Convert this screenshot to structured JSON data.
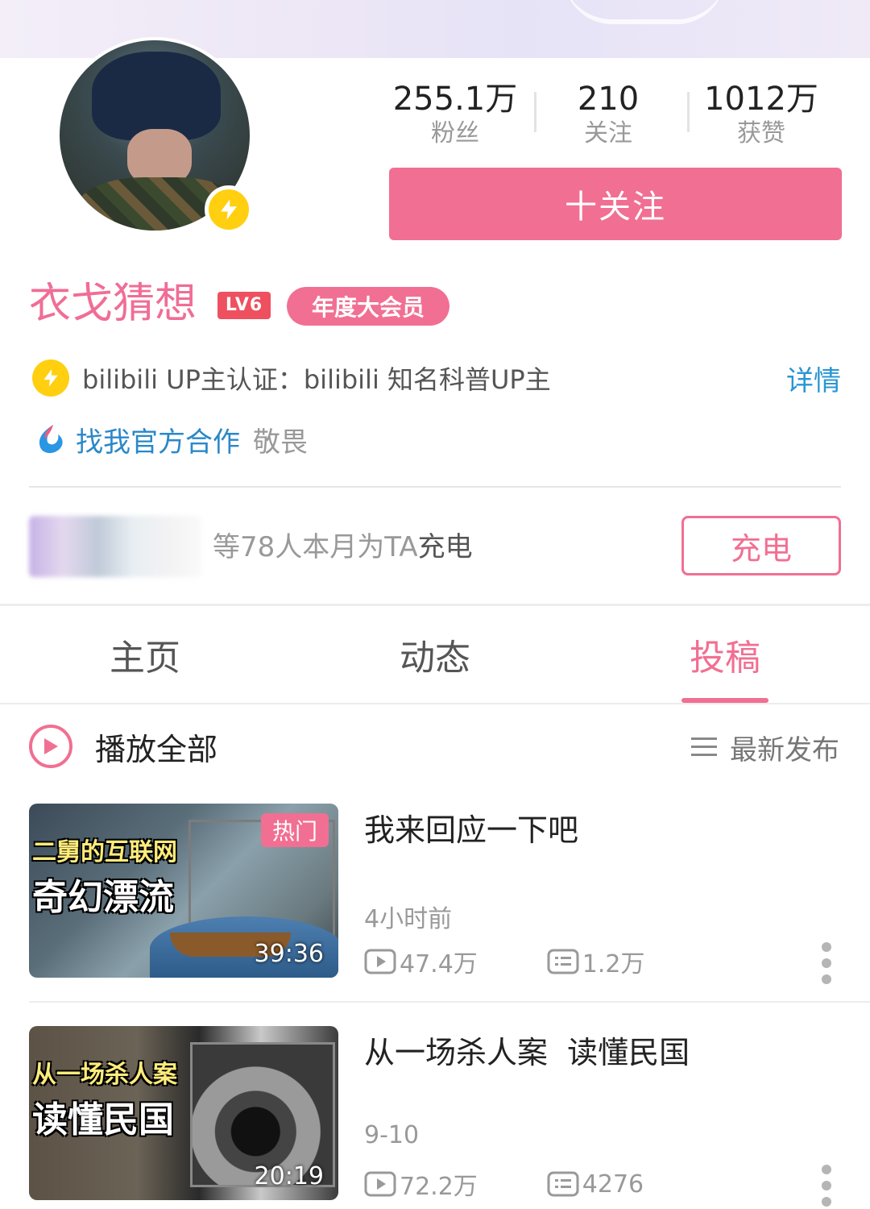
{
  "profile": {
    "name": "衣戈猜想",
    "level_badge": "LV6",
    "vip_badge": "年度大会员",
    "stats": [
      {
        "value": "255.1万",
        "label": "粉丝"
      },
      {
        "value": "210",
        "label": "关注"
      },
      {
        "value": "1012万",
        "label": "获赞"
      }
    ],
    "follow_button": "十关注",
    "certification": "bilibili UP主认证：bilibili 知名科普UP主",
    "cert_detail_link": "详情",
    "cooperation_link": "找我官方合作",
    "cooperation_sub": "敬畏",
    "charge_text_prefix": "等78人本月为TA",
    "charge_text_highlight": "充电",
    "charge_button": "充电"
  },
  "tabs": [
    {
      "label": "主页",
      "active": false
    },
    {
      "label": "动态",
      "active": false
    },
    {
      "label": "投稿",
      "active": true
    }
  ],
  "list_header": {
    "play_all": "播放全部",
    "sort_label": "最新发布"
  },
  "videos": [
    {
      "title": "我来回应一下吧",
      "date": "4小时前",
      "views": "47.4万",
      "comments": "1.2万",
      "duration": "39:36",
      "hot_tag": "热门",
      "thumb_text_top": "二舅的互联网",
      "thumb_text_bottom": "奇幻漂流"
    },
    {
      "title": "从一场杀人案  读懂民国",
      "date": "9-10",
      "views": "72.2万",
      "comments": "4276",
      "duration": "20:19",
      "thumb_text_top": "从一场杀人案",
      "thumb_text_bottom": "读懂民国"
    }
  ],
  "colors": {
    "accent_pink": "#f16f92",
    "link_blue": "#2a96d4",
    "verify_yellow": "#ffcf10"
  }
}
